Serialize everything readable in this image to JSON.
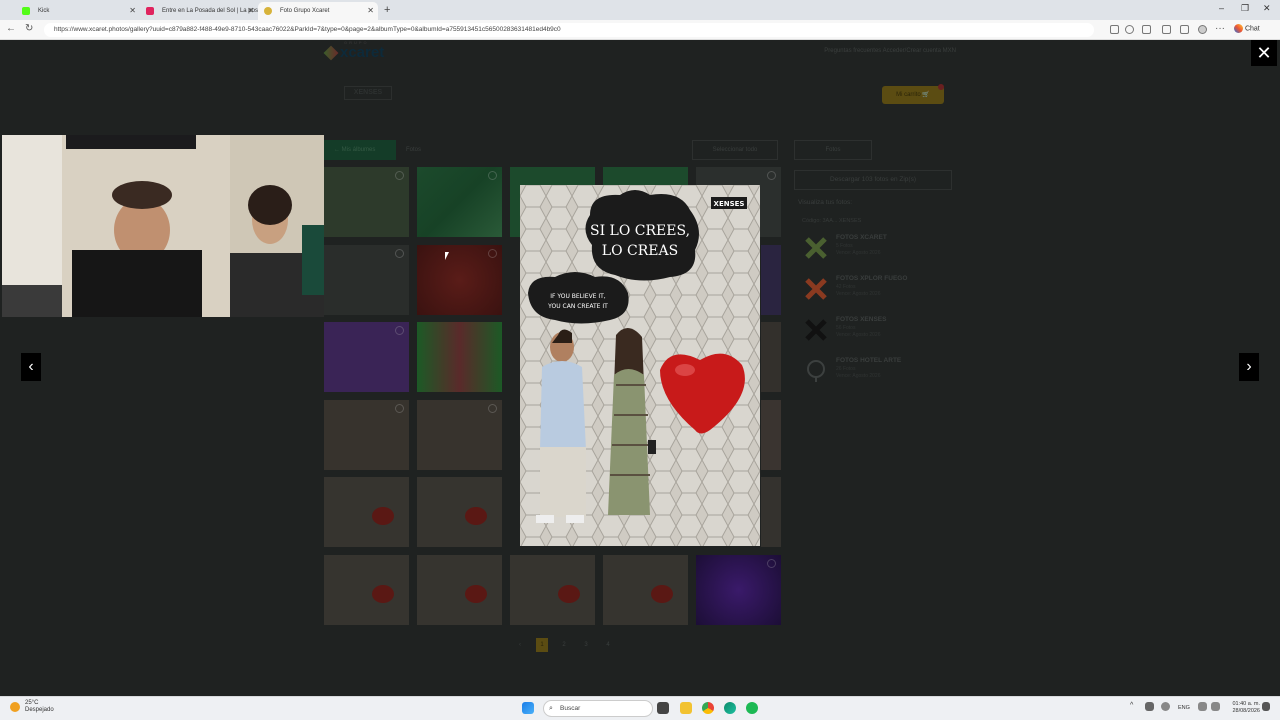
{
  "browser": {
    "tabs": [
      {
        "title": "Kick",
        "color": "#53fc18"
      },
      {
        "title": "Entre en La Posada del Sol | La pos",
        "color": "#e0245e"
      },
      {
        "title": "Foto Grupo Xcaret",
        "color": "#d7b33a"
      }
    ],
    "url": "https://www.xcaret.photos/gallery?uuid=c879a882-f488-49e9-8710-543caac76022&ParkId=7&type=0&page=2&albumType=0&albumId=a755913451c56500283631481ed4b9c0",
    "chat_label": "Chat"
  },
  "site": {
    "logo_top": "GRUPO",
    "logo_text": "xcaret",
    "nav": "Preguntas frecuentes   Acceder/Crear cuenta   MXN",
    "xenses_logo": "XENSES",
    "cart_label": "Mi carrito",
    "albums_button": "← Mis álbumes",
    "breadcrumb": "Fotos",
    "select_all": "Seleccionar todo",
    "fotos_button": "Fotos",
    "download_button": "Descargar 103 fotos en Zip(s)",
    "side_title": "Visualiza tus fotos:",
    "side_code": "Código: 3AA... XENSES",
    "albums": [
      {
        "name": "FOTOS XCARET",
        "meta": "5 Fotos\nVence: Agosto 2026",
        "color": "#5a6f3a"
      },
      {
        "name": "FOTOS XPLOR FUEGO",
        "meta": "42 Fotos\nVence: Agosto 2026",
        "color": "#a04628"
      },
      {
        "name": "FOTOS XENSES",
        "meta": "56 Fotos\nVence: Agosto 2026",
        "color": "#222222"
      },
      {
        "name": "FOTOS HOTEL ARTE",
        "meta": "26 Fotos\nVence: Agosto 2026",
        "color": "#3a3e3d"
      }
    ],
    "pages": [
      "‹",
      "1",
      "2",
      "3",
      "4"
    ],
    "current_page": "1"
  },
  "lightbox": {
    "sign_es": "SI LO CREES, LO CREAS",
    "sign_en": "IF YOU BELIEVE IT, YOU CAN CREATE IT",
    "watermark": "XENSES",
    "close": "✕",
    "prev": "‹",
    "next": "›"
  },
  "taskbar": {
    "weather_temp": "25°C",
    "weather_desc": "Despejado",
    "search": "Buscar",
    "lang": "ENG",
    "time": "01:40 a. m.",
    "date": "28/08/2026"
  }
}
